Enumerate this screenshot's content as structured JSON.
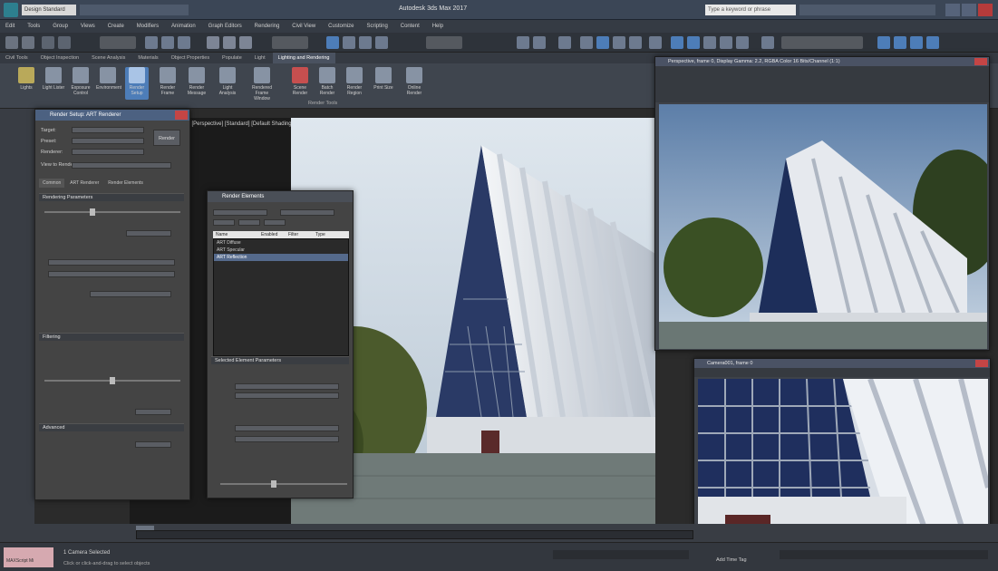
{
  "app": {
    "title": "Autodesk 3ds Max 2017",
    "workspace": "Design Standard",
    "search_placeholder": "Type a keyword or phrase"
  },
  "menu": [
    "Edit",
    "Tools",
    "Group",
    "Views",
    "Create",
    "Modifiers",
    "Animation",
    "Graph Editors",
    "Rendering",
    "Civil View",
    "Customize",
    "Scripting",
    "Content",
    "Help"
  ],
  "ribbon_tabs": [
    "Civil Tools",
    "Object Inspection",
    "Scene Analysis",
    "Materials",
    "Object Properties",
    "Populate",
    "Light",
    "Lighting and Rendering"
  ],
  "ribbon": {
    "buttons": [
      "Lights",
      "Light Lister",
      "Exposure Control",
      "Environment",
      "Render Setup",
      "Render Frame",
      "Render Message",
      "Light Analysis",
      "Rendered Frame Window",
      "Scene Render",
      "Batch Render",
      "Render Region",
      "Print Size",
      "Online Render"
    ],
    "group_label": "Render Tools"
  },
  "viewport": {
    "label": "[+] [Perspective] [Standard] [Default Shading]"
  },
  "render_setup": {
    "title": "Render Setup: ART Renderer",
    "fields": [
      "Target:",
      "Preset:",
      "Renderer:",
      "View to Render:"
    ],
    "tabs": [
      "Common",
      "ART Renderer",
      "Render Elements"
    ],
    "sections": [
      "Rendering Parameters",
      "Filtering",
      "Advanced"
    ],
    "render_button": "Render"
  },
  "explorer": {
    "title": "Render Elements",
    "columns": [
      "Name",
      "Enabled",
      "Filter",
      "Type"
    ],
    "rows": [
      "ART Diffuse",
      "ART Specular",
      "ART Reflection"
    ],
    "selected_index": 2,
    "section": "Selected Element Parameters"
  },
  "render_window_1": {
    "title": "Perspective, frame 0, Display Gamma: 2.2, RGBA Color 16 Bits/Channel (1:1)"
  },
  "render_window_2": {
    "title": "Camera001, frame 0"
  },
  "status": {
    "message": "1 Camera Selected",
    "prompt": "Click or click-and-drag to select objects",
    "listener": "MAXScript Mi",
    "add_time_tag": "Add Time Tag"
  },
  "colors": {
    "accent": "#4d7db8",
    "title_bar": "#3b4656",
    "panel": "#444444",
    "close": "#c44545"
  }
}
